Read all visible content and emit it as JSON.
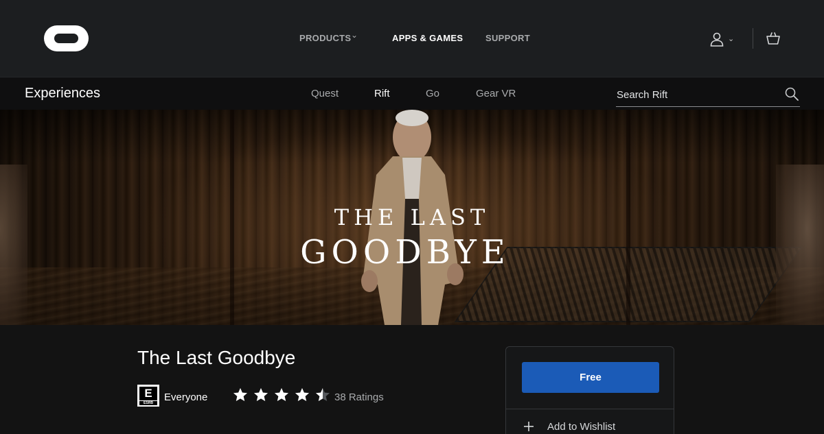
{
  "topnav": {
    "products_label": "PRODUCTS",
    "apps_games_label": "APPS & GAMES",
    "support_label": "SUPPORT"
  },
  "subnav": {
    "title": "Experiences",
    "tabs": [
      "Quest",
      "Rift",
      "Go",
      "Gear VR"
    ],
    "active_tab": "Rift",
    "search_placeholder": "Search Rift"
  },
  "hero": {
    "title_line1": "THE LAST",
    "title_line2": "GOODBYE"
  },
  "product": {
    "title": "The Last Goodbye",
    "esrb_letter": "E",
    "esrb_brand": "ESRB",
    "esrb_rating": "Everyone",
    "stars": 4.5,
    "ratings_count": "38 Ratings"
  },
  "purchase": {
    "button_label": "Free",
    "wishlist_label": "Add to Wishlist",
    "button_color": "#1b5bb7"
  },
  "icons": [
    "oculus-logo",
    "chevron-down-icon",
    "user-icon",
    "cart-icon",
    "search-icon",
    "star-icon",
    "plus-icon"
  ]
}
